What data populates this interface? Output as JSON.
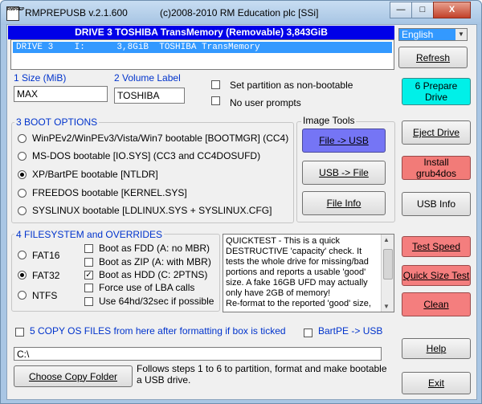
{
  "window": {
    "title": "RMPREPUSB v.2.1.600",
    "copyright": "(c)2008-2010 RM Education plc [SSi]",
    "icon_text": "RMPREP",
    "buttons": {
      "minimize": "—",
      "maximize": "□",
      "close": "X"
    }
  },
  "drive": {
    "header": "DRIVE 3 TOSHIBA TransMemory  (Removable) 3,843GiB",
    "list_item": "DRIVE 3    I:      3,8GiB  TOSHIBA TransMemory"
  },
  "language": {
    "selected": "English"
  },
  "size": {
    "label": "1 Size (MiB)",
    "value": "MAX"
  },
  "volume": {
    "label": "2 Volume Label",
    "value": "TOSHIBA"
  },
  "options": {
    "non_bootable": "Set partition as non-bootable",
    "no_prompts": "No user prompts"
  },
  "boot": {
    "title": "3 BOOT OPTIONS",
    "items": [
      {
        "label": "WinPEv2/WinPEv3/Vista/Win7 bootable [BOOTMGR] (CC4)",
        "selected": false
      },
      {
        "label": "MS-DOS bootable [IO.SYS]   (CC3 and CC4DOSUFD)",
        "selected": false
      },
      {
        "label": "XP/BartPE bootable [NTLDR]",
        "selected": true
      },
      {
        "label": "FREEDOS bootable [KERNEL.SYS]",
        "selected": false
      },
      {
        "label": "SYSLINUX bootable [LDLINUX.SYS + SYSLINUX.CFG]",
        "selected": false
      }
    ]
  },
  "image_tools": {
    "title": "Image Tools",
    "file_to_usb": "File -> USB",
    "usb_to_file": "USB -> File",
    "file_info": "File Info"
  },
  "fs": {
    "title": "4 FILESYSTEM and OVERRIDES",
    "types": [
      {
        "label": "FAT16",
        "selected": false
      },
      {
        "label": "FAT32",
        "selected": true
      },
      {
        "label": "NTFS",
        "selected": false
      }
    ],
    "overrides": [
      {
        "label": "Boot as FDD (A: no MBR)",
        "checked": false
      },
      {
        "label": "Boot as ZIP (A: with MBR)",
        "checked": false
      },
      {
        "label": "Boot as HDD (C: 2PTNS)",
        "checked": true
      },
      {
        "label": "Force use of LBA calls",
        "checked": false
      },
      {
        "label": "Use 64hd/32sec if possible",
        "checked": false
      }
    ]
  },
  "info_text": "QUICKTEST - This is a quick DESTRUCTIVE 'capacity' check. It tests the whole drive for missing/bad portions and reports a usable 'good' size. A fake 16GB UFD may actually only have 2GB of memory!\nRe-format to the reported 'good' size,",
  "copy": {
    "label": "5 COPY OS FILES from here after formatting if box is ticked",
    "bartpe": "BartPE -> USB",
    "path": "C:\\",
    "choose_button": "Choose Copy Folder",
    "footer": "Follows steps 1 to 6 to partition, format and make bootable a USB drive."
  },
  "side_buttons": {
    "refresh": "Refresh",
    "prepare": "6 Prepare Drive",
    "eject": "Eject Drive",
    "grub": "Install grub4dos",
    "usb_info": "USB Info",
    "test_speed": "Test Speed",
    "quick_size": "Quick Size Test",
    "clean": "Clean",
    "help": "Help",
    "exit": "Exit"
  },
  "colors": {
    "prepare": "#00f0e8",
    "file_to_usb": "#7575f5",
    "grub": "#f27b78",
    "test_buttons": "#f47e7e",
    "drive_highlight": "#3399ff",
    "header_bg": "#0000e8"
  }
}
